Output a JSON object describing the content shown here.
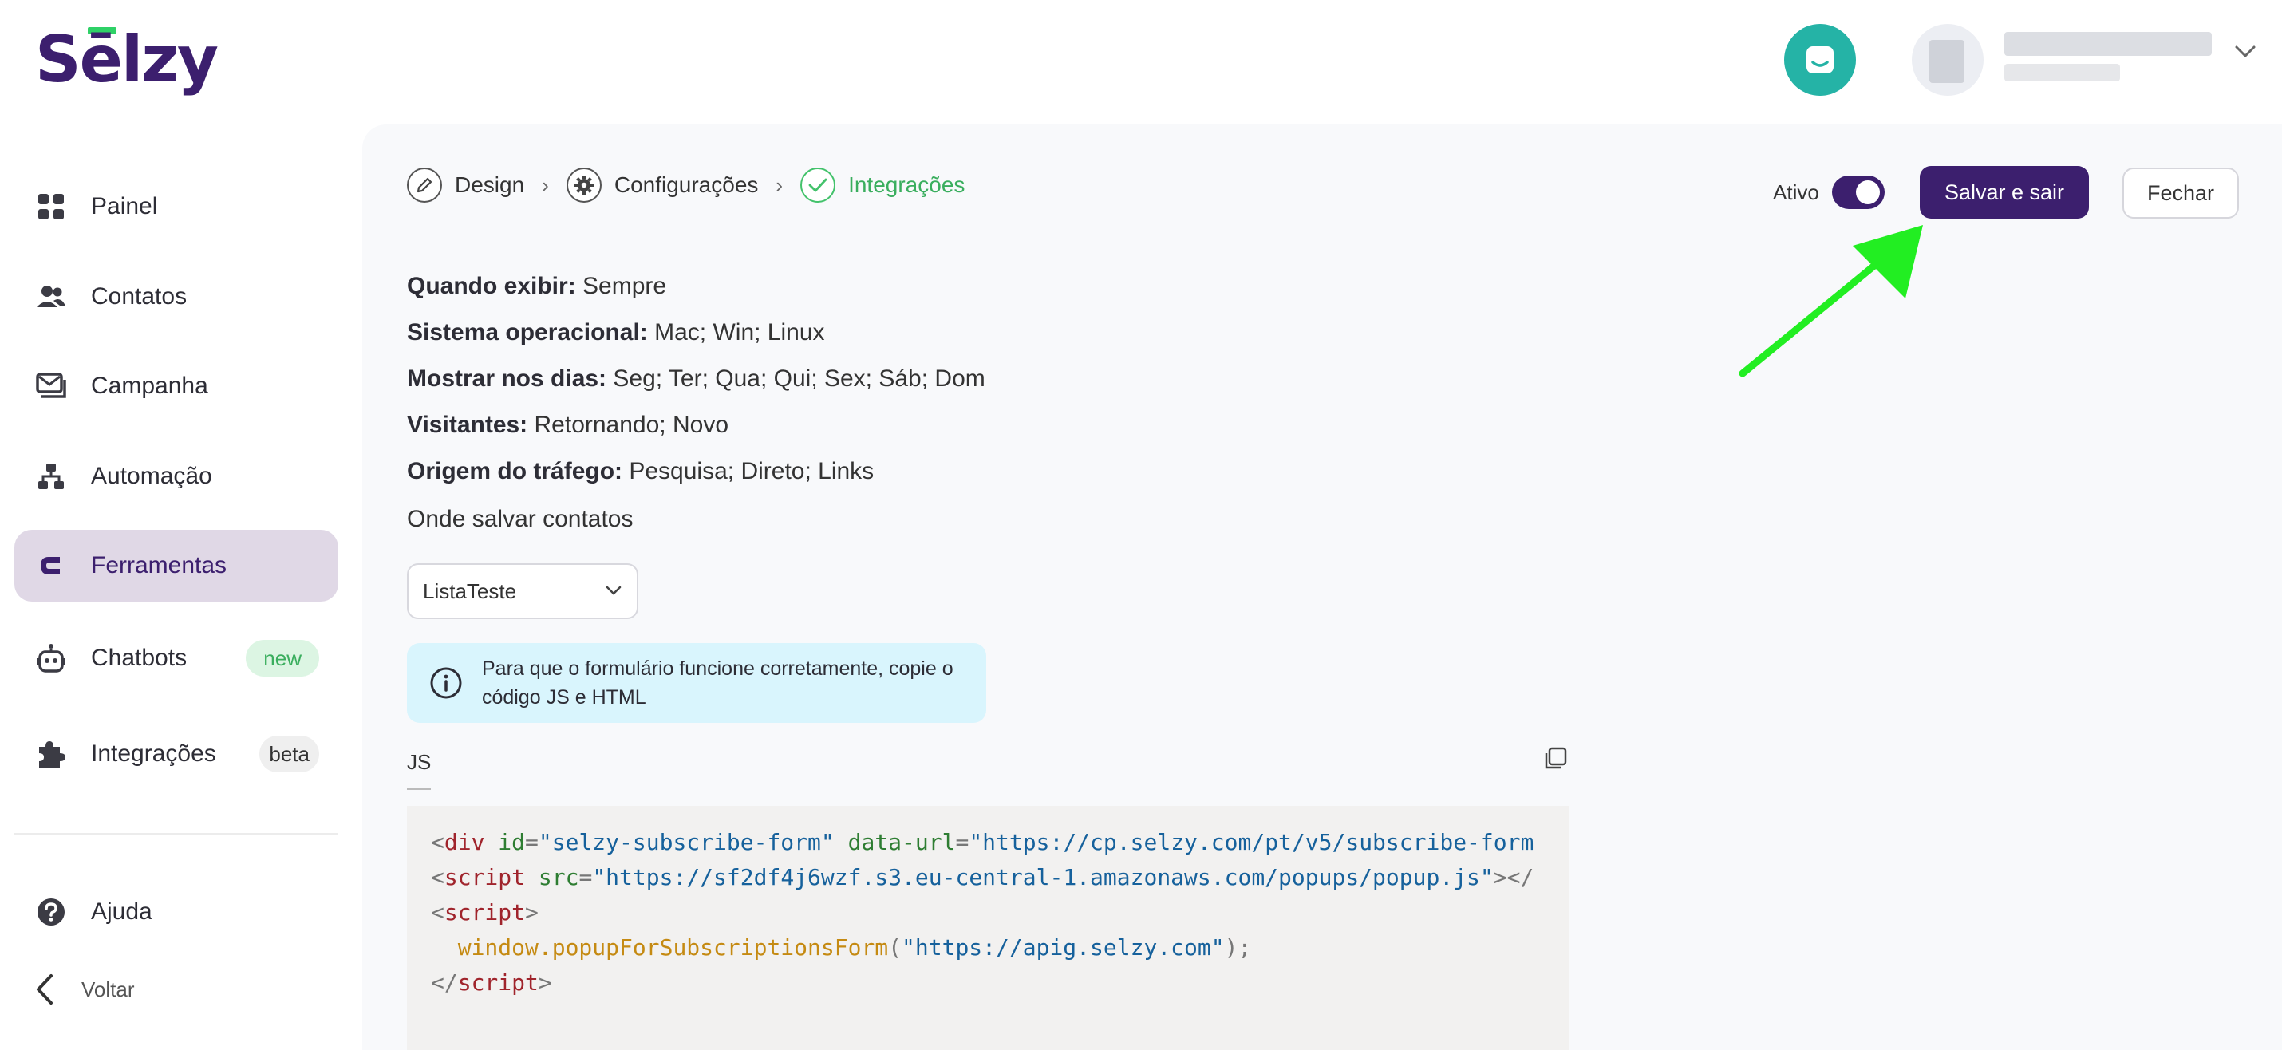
{
  "brand": {
    "logo_text": "Sēlzy"
  },
  "sidebar": {
    "items": [
      {
        "label": "Painel",
        "icon": "dashboard-icon"
      },
      {
        "label": "Contatos",
        "icon": "contacts-icon"
      },
      {
        "label": "Campanha",
        "icon": "campaign-icon"
      },
      {
        "label": "Automação",
        "icon": "automation-icon"
      },
      {
        "label": "Ferramentas",
        "icon": "magnet-icon",
        "active": true
      },
      {
        "label": "Chatbots",
        "icon": "robot-icon",
        "badge": "new"
      },
      {
        "label": "Integrações",
        "icon": "puzzle-icon",
        "badge": "beta"
      }
    ],
    "help_label": "Ajuda",
    "back_label": "Voltar"
  },
  "steps": [
    {
      "label": "Design",
      "icon": "pencil-icon"
    },
    {
      "label": "Configurações",
      "icon": "gear-icon"
    },
    {
      "label": "Integrações",
      "icon": "check-icon",
      "done": true
    }
  ],
  "toolbar": {
    "active_label": "Ativo",
    "active": true,
    "save_label": "Salvar e sair",
    "close_label": "Fechar"
  },
  "settings": [
    {
      "label": "Quando exibir:",
      "value": "Sempre"
    },
    {
      "label": "Sistema operacional:",
      "value": "Mac; Win; Linux"
    },
    {
      "label": "Mostrar nos dias:",
      "value": "Seg; Ter; Qua; Qui; Sex; Sáb; Dom"
    },
    {
      "label": "Visitantes:",
      "value": "Retornando; Novo"
    },
    {
      "label": "Origem do tráfego:",
      "value": "Pesquisa; Direto; Links"
    }
  ],
  "save_contacts": {
    "title": "Onde salvar contatos",
    "selected_list": "ListaTeste"
  },
  "notice": {
    "text": "Para que o formulário funcione corretamente, copie o código JS e HTML"
  },
  "code_tab": {
    "label": "JS"
  },
  "code": {
    "l1_tag": "div",
    "l1_attr1": "id",
    "l1_val1": "\"selzy-subscribe-form\"",
    "l1_attr2": "data-url",
    "l1_val2": "\"https://cp.selzy.com/pt/v5/subscribe-form",
    "l2_tag": "script",
    "l2_attr": "src",
    "l2_val": "\"https://sf2df4j6wzf.s3.eu-central-1.amazonaws.com/popups/popup.js\"",
    "l3_tag": "script",
    "l4_fn": "window.popupForSubscriptionsForm",
    "l4_arg": "\"https://apig.selzy.com\"",
    "l5_tag": "script"
  },
  "colors": {
    "brand": "#3c1f6e",
    "success": "#43c26b",
    "support": "#25b3a6",
    "notice_bg": "#d9f5fd",
    "annotation_arrow": "#22ee22"
  }
}
